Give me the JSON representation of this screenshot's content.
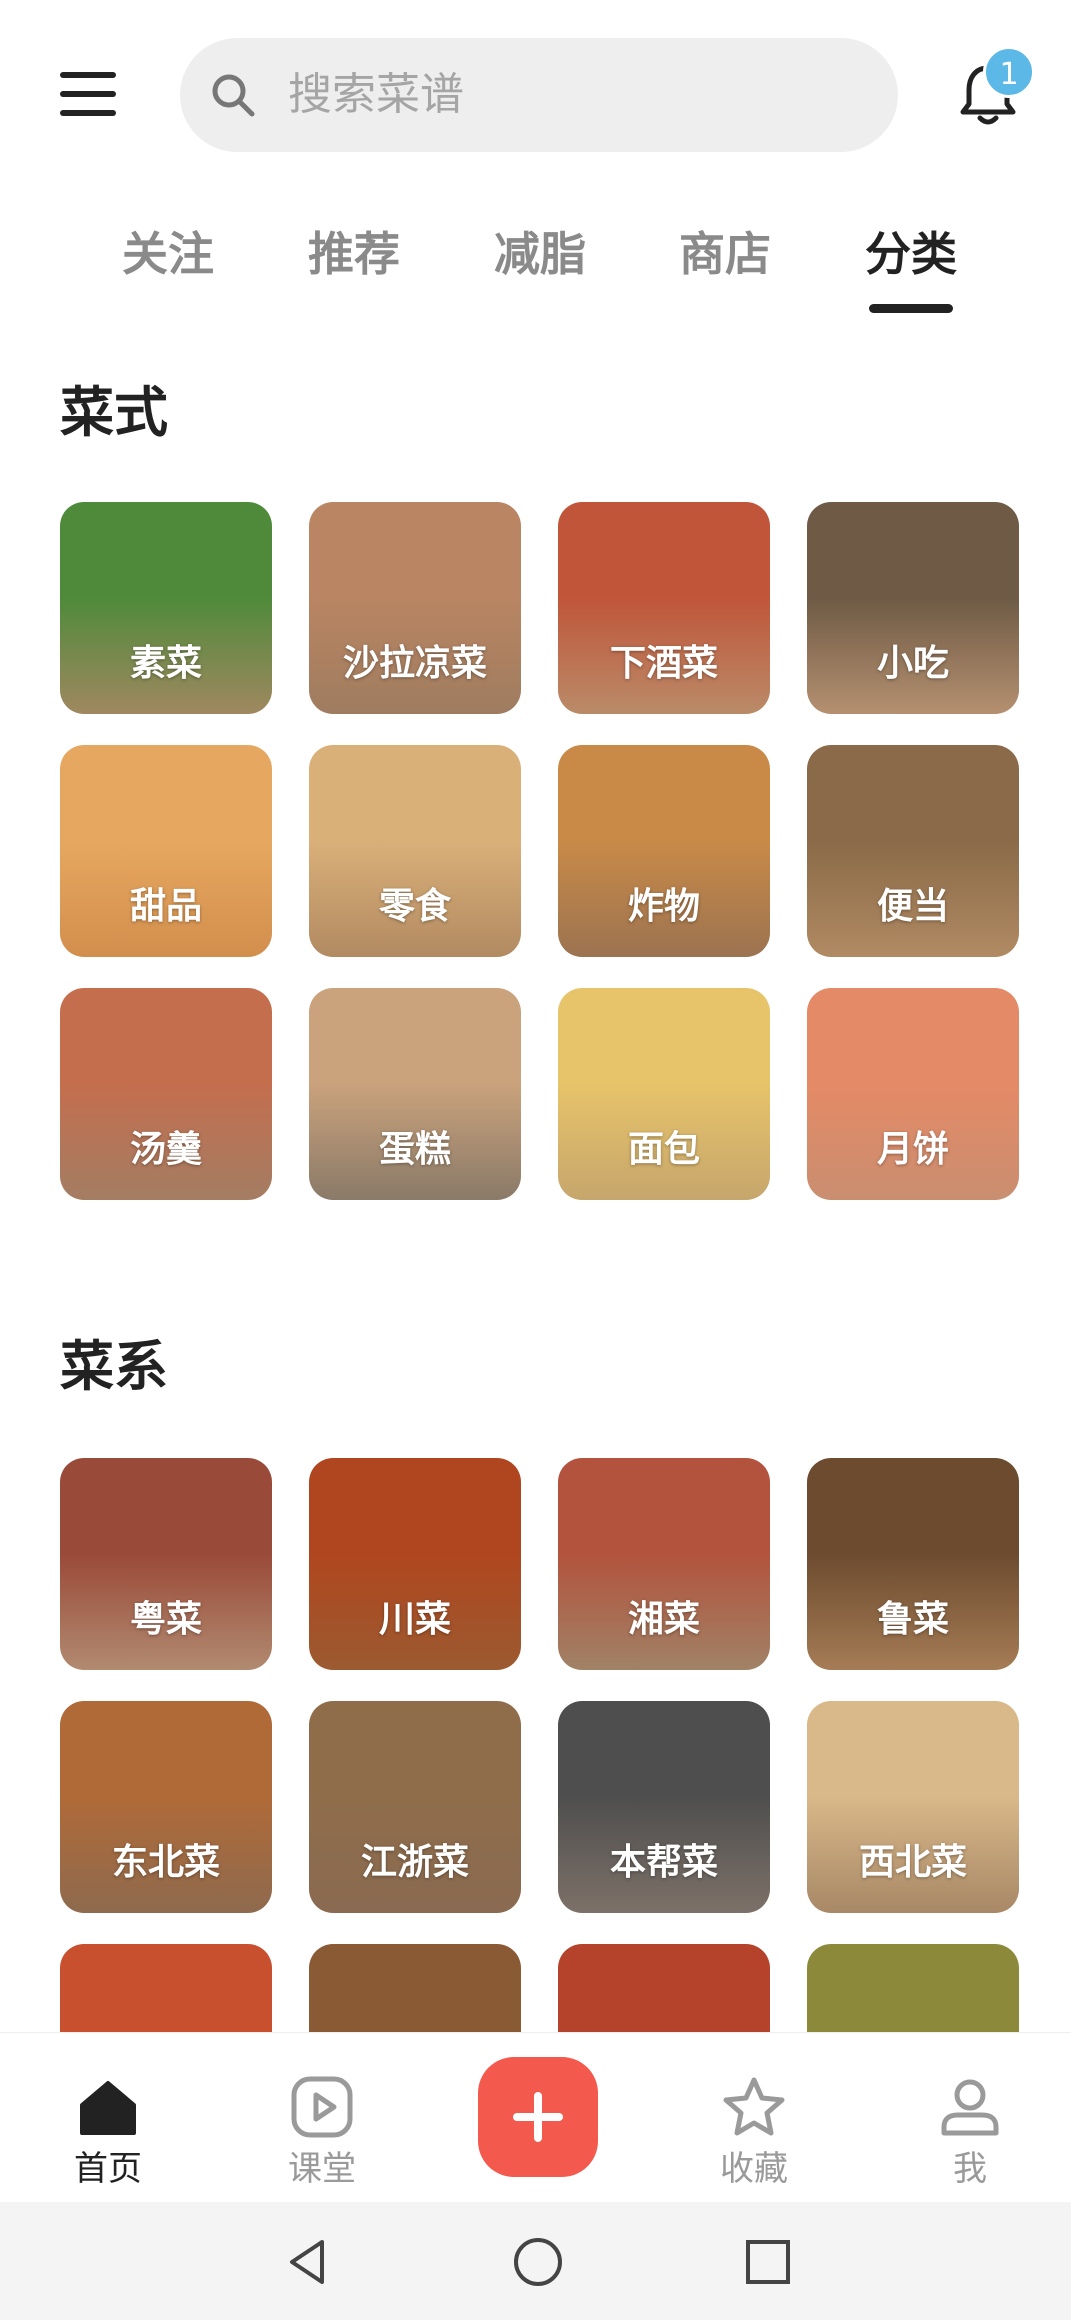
{
  "header": {
    "search_placeholder": "搜索菜谱",
    "notification_count": "1"
  },
  "tabs": [
    {
      "label": "关注"
    },
    {
      "label": "推荐"
    },
    {
      "label": "减脂"
    },
    {
      "label": "商店"
    },
    {
      "label": "分类",
      "active": true
    }
  ],
  "sections": [
    {
      "title": "菜式",
      "items": [
        {
          "label": "素菜",
          "top": "#4f8a3a",
          "bottom": "#a08860"
        },
        {
          "label": "沙拉凉菜",
          "top": "#b98562",
          "bottom": "#9f7c60"
        },
        {
          "label": "下酒菜",
          "top": "#c0553a",
          "bottom": "#ba8b68"
        },
        {
          "label": "小吃",
          "top": "#6e5a45",
          "bottom": "#b59070"
        },
        {
          "label": "甜品",
          "top": "#e6a860",
          "bottom": "#d28e4d"
        },
        {
          "label": "零食",
          "top": "#d9b078",
          "bottom": "#b28a62"
        },
        {
          "label": "炸物",
          "top": "#c98a48",
          "bottom": "#9c7350"
        },
        {
          "label": "便当",
          "top": "#8a6a48",
          "bottom": "#b08a62"
        },
        {
          "label": "汤羹",
          "top": "#c46e4e",
          "bottom": "#a47d63"
        },
        {
          "label": "蛋糕",
          "top": "#caa27c",
          "bottom": "#8a7a68"
        },
        {
          "label": "面包",
          "top": "#e7c36a",
          "bottom": "#c6a66c"
        },
        {
          "label": "月饼",
          "top": "#e58a66",
          "bottom": "#c98e70"
        }
      ]
    },
    {
      "title": "菜系",
      "items": [
        {
          "label": "粤菜",
          "top": "#9a4a38",
          "bottom": "#b18a70"
        },
        {
          "label": "川菜",
          "top": "#b0461f",
          "bottom": "#9c5a30"
        },
        {
          "label": "湘菜",
          "top": "#b3533d",
          "bottom": "#a08266"
        },
        {
          "label": "鲁菜",
          "top": "#6d4b2f",
          "bottom": "#a57c55"
        },
        {
          "label": "东北菜",
          "top": "#b06a38",
          "bottom": "#8e6a4e"
        },
        {
          "label": "江浙菜",
          "top": "#8f6d4b",
          "bottom": "#8a6a50"
        },
        {
          "label": "本帮菜",
          "top": "#4e4e4e",
          "bottom": "#7d7168"
        },
        {
          "label": "西北菜",
          "top": "#d9b889",
          "bottom": "#a88866"
        },
        {
          "label": "",
          "top": "#c8502e",
          "bottom": "#c8502e"
        },
        {
          "label": "",
          "top": "#8a5a35",
          "bottom": "#8a5a35"
        },
        {
          "label": "",
          "top": "#b5422a",
          "bottom": "#b5422a"
        },
        {
          "label": "",
          "top": "#8c8a3a",
          "bottom": "#8c8a3a"
        }
      ]
    }
  ],
  "bottom_nav": [
    {
      "label": "首页",
      "icon": "home-icon",
      "active": true
    },
    {
      "label": "课堂",
      "icon": "play-icon"
    },
    {
      "label": "",
      "icon": "plus-icon"
    },
    {
      "label": "收藏",
      "icon": "star-icon"
    },
    {
      "label": "我",
      "icon": "user-icon"
    }
  ],
  "colors": {
    "accent": "#f3594c",
    "badge": "#5cb8e6"
  }
}
